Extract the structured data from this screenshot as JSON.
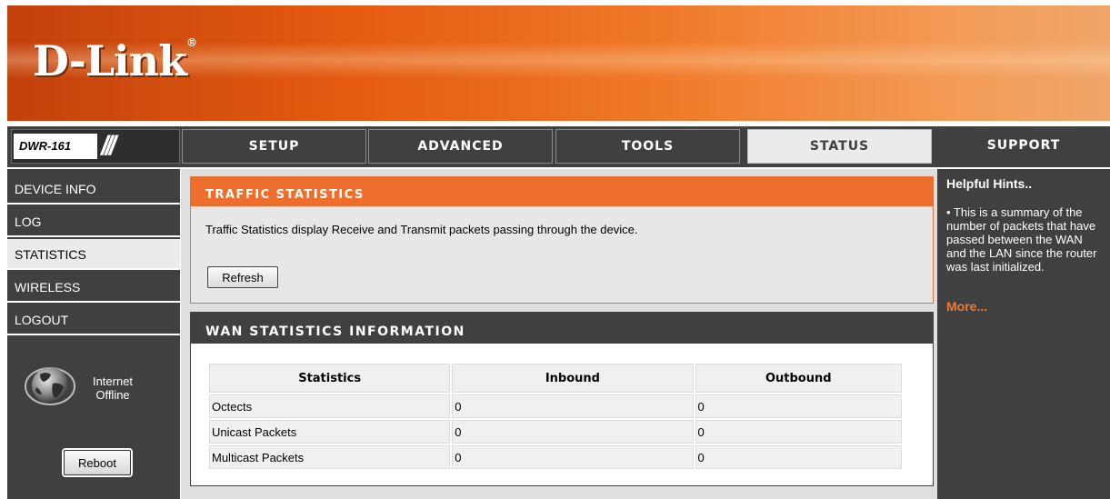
{
  "header": {
    "brand": "D-Link",
    "registered": "®"
  },
  "nav": {
    "model": "DWR-161",
    "slashes": "///",
    "tabs": [
      {
        "label": "SETUP",
        "active": false
      },
      {
        "label": "ADVANCED",
        "active": false
      },
      {
        "label": "TOOLS",
        "active": false
      },
      {
        "label": "STATUS",
        "active": true
      },
      {
        "label": "SUPPORT",
        "active": false
      }
    ]
  },
  "sidebar": {
    "items": [
      {
        "label": "DEVICE INFO",
        "active": false
      },
      {
        "label": "LOG",
        "active": false
      },
      {
        "label": "STATISTICS",
        "active": true
      },
      {
        "label": "WIRELESS",
        "active": false
      },
      {
        "label": "LOGOUT",
        "active": false
      }
    ],
    "internet_line1": "Internet",
    "internet_line2": "Offline",
    "reboot_label": "Reboot"
  },
  "traffic": {
    "title": "TRAFFIC STATISTICS",
    "description": "Traffic Statistics display Receive and Transmit packets passing through the device.",
    "refresh_label": "Refresh"
  },
  "wan": {
    "title": "WAN STATISTICS INFORMATION",
    "columns": [
      "Statistics",
      "Inbound",
      "Outbound"
    ],
    "rows": [
      [
        "Octects",
        "0",
        "0"
      ],
      [
        "Unicast Packets",
        "0",
        "0"
      ],
      [
        "Multicast Packets",
        "0",
        "0"
      ]
    ]
  },
  "hints": {
    "title": "Helpful Hints..",
    "text": "• This is a summary of the number of packets that have passed between the WAN and the LAN since the router was last initialized.",
    "more": "More..."
  },
  "colors": {
    "accent_orange": "#ee6f2d",
    "dark_gray": "#404040",
    "panel_gray": "#dfdfdf"
  },
  "icons": {
    "globe": "globe-icon"
  }
}
